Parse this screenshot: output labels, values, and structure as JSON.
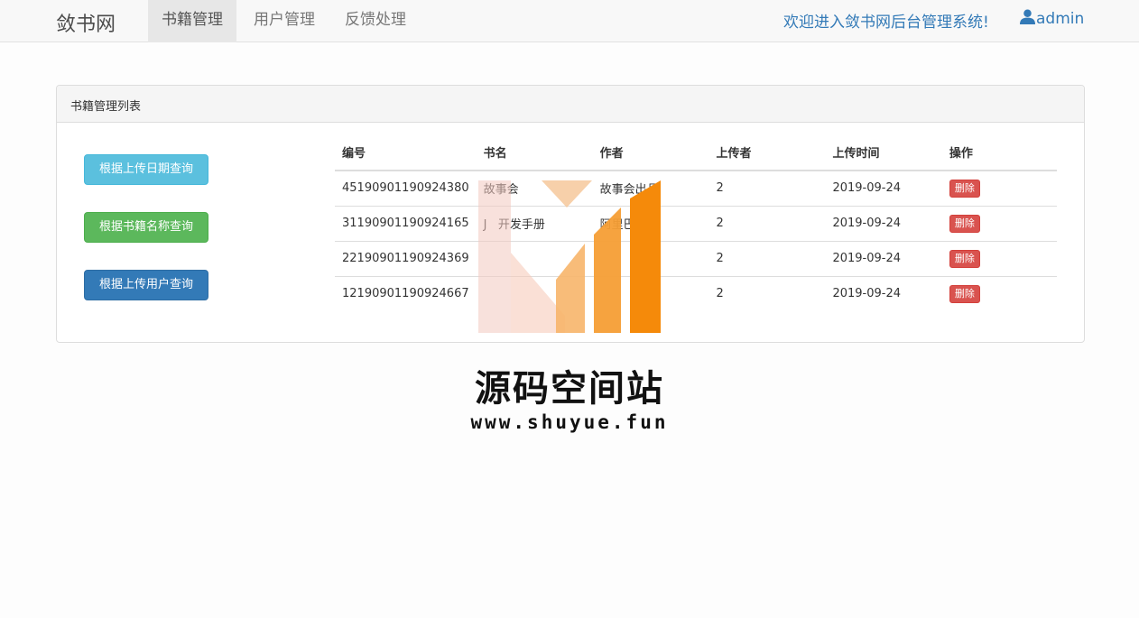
{
  "navbar": {
    "brand": "敛书网",
    "items": [
      {
        "label": "书籍管理",
        "active": true
      },
      {
        "label": "用户管理",
        "active": false
      },
      {
        "label": "反馈处理",
        "active": false
      }
    ],
    "welcome": "欢迎进入敛书网后台管理系统!",
    "user": "admin",
    "user_icon": "user-icon"
  },
  "panel": {
    "title": "书籍管理列表",
    "query_buttons": [
      "根据上传日期查询",
      "根据书籍名称查询",
      "根据上传用户查询"
    ],
    "table": {
      "headers": [
        "编号",
        "书名",
        "作者",
        "上传者",
        "上传时间",
        "操作"
      ],
      "rows": [
        {
          "id": "45190901190924380",
          "name": "故事会",
          "author": "故事会出品",
          "uploader": "2",
          "time": "2019-09-24",
          "action": "删除"
        },
        {
          "id": "31190901190924165",
          "name": "J   开发手册",
          "author": "阿里巴",
          "uploader": "2",
          "time": "2019-09-24",
          "action": "删除"
        },
        {
          "id": "22190901190924369",
          "name": "",
          "author": "",
          "uploader": "2",
          "time": "2019-09-24",
          "action": "删除"
        },
        {
          "id": "12190901190924667",
          "name": "",
          "author": "",
          "uploader": "2",
          "time": "2019-09-24",
          "action": "删除"
        }
      ]
    }
  },
  "watermark": {
    "title": "源码空间站",
    "url": "www.shuyue.fun"
  },
  "colors": {
    "link": "#337ab7",
    "info": "#5bc0de",
    "success": "#5cb85c",
    "primary": "#337ab7",
    "danger": "#d9534f"
  }
}
